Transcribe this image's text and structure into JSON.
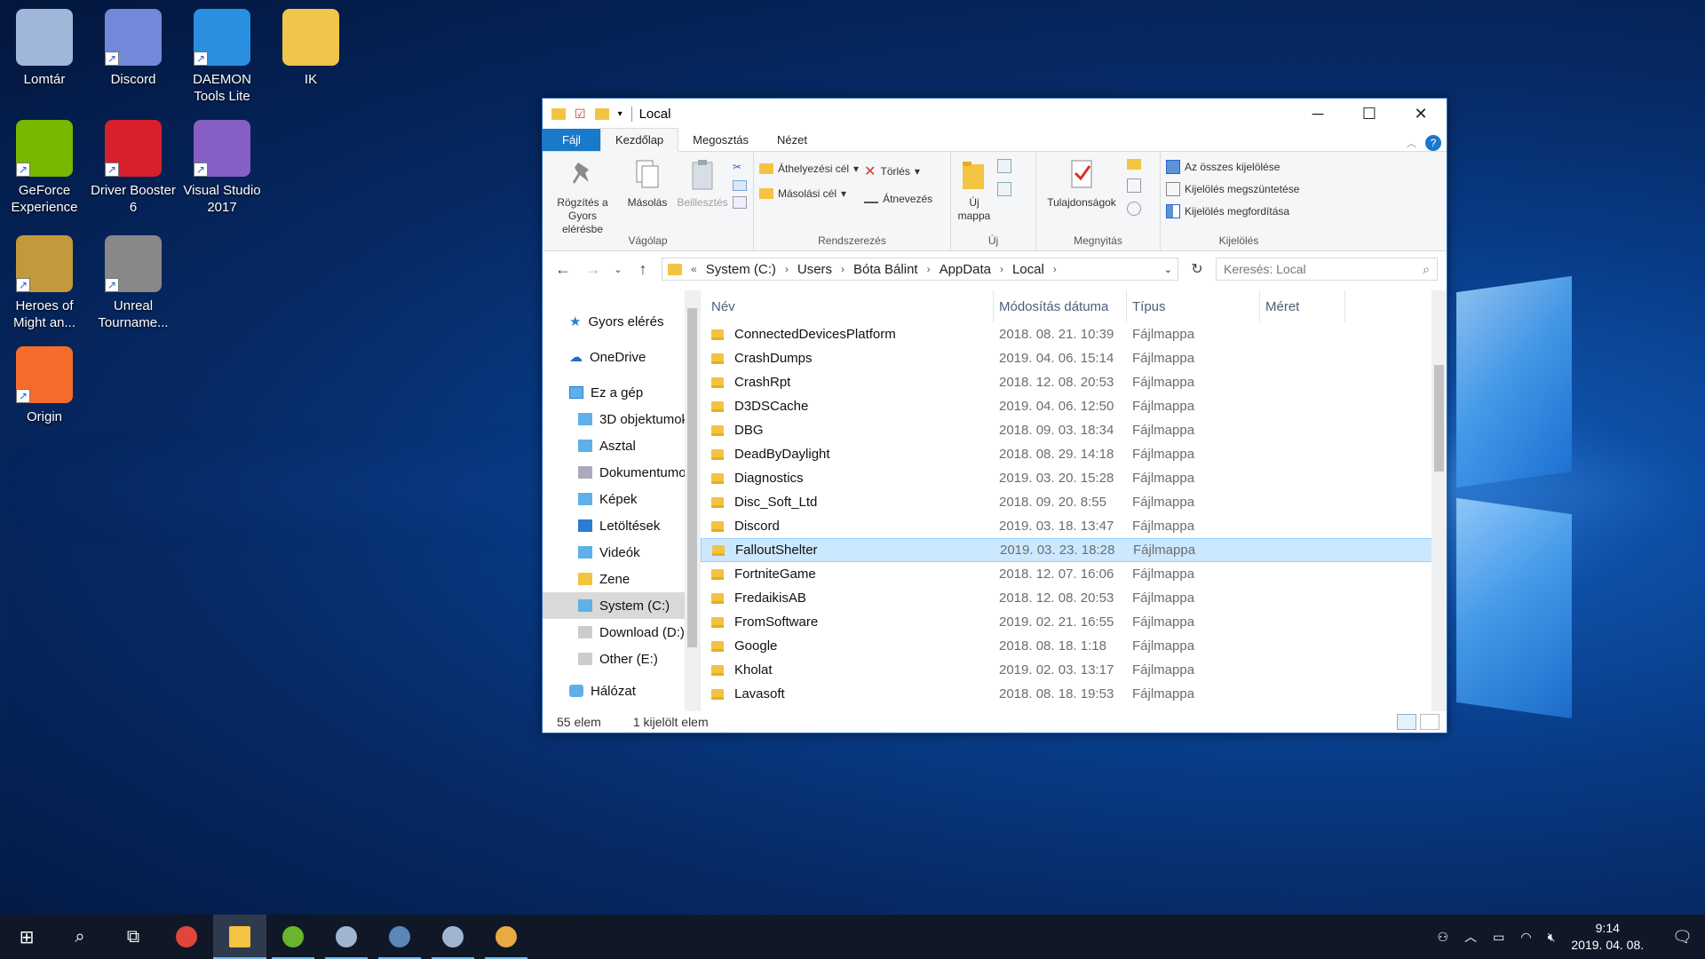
{
  "desktop": {
    "icons": [
      {
        "label": "Lomtár",
        "icon": "recycle-bin-icon",
        "color": "#9fb7d8"
      },
      {
        "label": "Discord",
        "icon": "discord-icon",
        "color": "#7289da"
      },
      {
        "label": "DAEMON Tools Lite",
        "icon": "daemon-tools-icon",
        "color": "#2a8fe0"
      },
      {
        "label": "IK",
        "icon": "folder-icon",
        "color": "#f1c44a"
      },
      {
        "label": "GeForce Experience",
        "icon": "geforce-icon",
        "color": "#76b900"
      },
      {
        "label": "Driver Booster 6",
        "icon": "driver-booster-icon",
        "color": "#d7202b"
      },
      {
        "label": "Visual Studio 2017",
        "icon": "visual-studio-icon",
        "color": "#865fc5"
      },
      {
        "label": "Heroes of Might an...",
        "icon": "heroes-icon",
        "color": "#c29a3b"
      },
      {
        "label": "Unreal Tourname...",
        "icon": "unreal-tournament-icon",
        "color": "#888"
      },
      {
        "label": "Origin",
        "icon": "origin-icon",
        "color": "#f56c2d"
      }
    ]
  },
  "window": {
    "title": "Local",
    "controls": {
      "minimize": "─",
      "maximize": "☐",
      "close": "✕"
    }
  },
  "ribbon": {
    "tabs": [
      "Fájl",
      "Kezdőlap",
      "Megosztás",
      "Nézet"
    ],
    "help": "?",
    "clipboard": {
      "pin": "Rögzítés a Gyors elérésbe",
      "copy": "Másolás",
      "paste": "Beillesztés",
      "group": "Vágólap"
    },
    "organize": {
      "move_to": "Áthelyezési cél",
      "copy_to": "Másolási cél",
      "delete": "Törlés",
      "rename": "Átnevezés",
      "group": "Rendszerezés"
    },
    "new": {
      "new_folder": "Új mappa",
      "group": "Új"
    },
    "open": {
      "properties": "Tulajdonságok",
      "group": "Megnyitás"
    },
    "select": {
      "select_all": "Az összes kijelölése",
      "select_none": "Kijelölés megszüntetése",
      "invert": "Kijelölés megfordítása",
      "group": "Kijelölés"
    }
  },
  "address": {
    "lead": "«",
    "crumbs": [
      "System (C:)",
      "Users",
      "Bóta Bálint",
      "AppData",
      "Local"
    ],
    "search_placeholder": "Keresés: Local"
  },
  "nav": {
    "quick_access": "Gyors elérés",
    "onedrive": "OneDrive",
    "this_pc": "Ez a gép",
    "items": [
      "3D objektumok",
      "Asztal",
      "Dokumentumok",
      "Képek",
      "Letöltések",
      "Videók",
      "Zene",
      "System (C:)",
      "Download (D:)",
      "Other (E:)"
    ],
    "network": "Hálózat"
  },
  "columns": {
    "name": "Név",
    "date": "Módosítás dátuma",
    "type": "Típus",
    "size": "Méret"
  },
  "files": [
    {
      "name": "ConnectedDevicesPlatform",
      "date": "2018. 08. 21. 10:39",
      "type": "Fájlmappa"
    },
    {
      "name": "CrashDumps",
      "date": "2019. 04. 06. 15:14",
      "type": "Fájlmappa"
    },
    {
      "name": "CrashRpt",
      "date": "2018. 12. 08. 20:53",
      "type": "Fájlmappa"
    },
    {
      "name": "D3DSCache",
      "date": "2019. 04. 06. 12:50",
      "type": "Fájlmappa"
    },
    {
      "name": "DBG",
      "date": "2018. 09. 03. 18:34",
      "type": "Fájlmappa"
    },
    {
      "name": "DeadByDaylight",
      "date": "2018. 08. 29. 14:18",
      "type": "Fájlmappa"
    },
    {
      "name": "Diagnostics",
      "date": "2019. 03. 20. 15:28",
      "type": "Fájlmappa"
    },
    {
      "name": "Disc_Soft_Ltd",
      "date": "2018. 09. 20. 8:55",
      "type": "Fájlmappa"
    },
    {
      "name": "Discord",
      "date": "2019. 03. 18. 13:47",
      "type": "Fájlmappa"
    },
    {
      "name": "FalloutShelter",
      "date": "2019. 03. 23. 18:28",
      "type": "Fájlmappa"
    },
    {
      "name": "FortniteGame",
      "date": "2018. 12. 07. 16:06",
      "type": "Fájlmappa"
    },
    {
      "name": "FredaikisAB",
      "date": "2018. 12. 08. 20:53",
      "type": "Fájlmappa"
    },
    {
      "name": "FromSoftware",
      "date": "2019. 02. 21. 16:55",
      "type": "Fájlmappa"
    },
    {
      "name": "Google",
      "date": "2018. 08. 18. 1:18",
      "type": "Fájlmappa"
    },
    {
      "name": "Kholat",
      "date": "2019. 02. 03. 13:17",
      "type": "Fájlmappa"
    },
    {
      "name": "Lavasoft",
      "date": "2018. 08. 18. 19:53",
      "type": "Fájlmappa"
    }
  ],
  "status": {
    "count": "55 elem",
    "selected": "1 kijelölt elem"
  },
  "taskbar": {
    "apps": [
      "start-icon",
      "search-icon",
      "task-view-icon",
      "chrome-icon",
      "file-explorer-icon",
      "utorrent-icon",
      "steam-icon",
      "teamspeak-icon",
      "steam-icon",
      "paint-icon"
    ],
    "time": "9:14",
    "date": "2019. 04. 08."
  }
}
